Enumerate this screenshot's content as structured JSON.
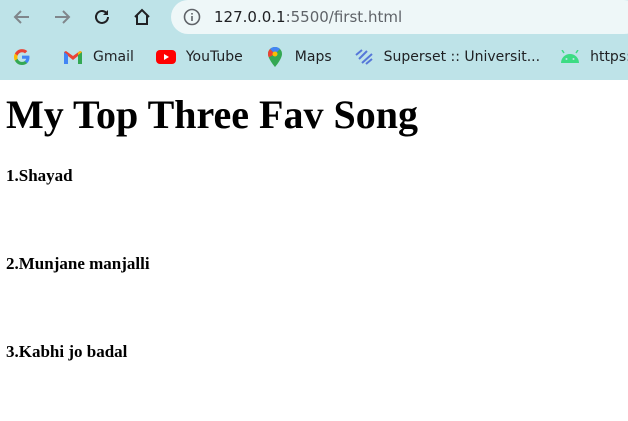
{
  "browser": {
    "url_host": "127.0.0.1",
    "url_rest": ":5500/first.html",
    "bookmarks": [
      {
        "label": "",
        "icon": "google-icon"
      },
      {
        "label": "Gmail",
        "icon": "gmail-icon"
      },
      {
        "label": "YouTube",
        "icon": "youtube-icon"
      },
      {
        "label": "Maps",
        "icon": "maps-icon"
      },
      {
        "label": "Superset :: Universit...",
        "icon": "superset-icon"
      },
      {
        "label": "https://dev",
        "icon": "android-icon"
      }
    ],
    "colors": {
      "chrome_bg": "#bee3e8",
      "omnibox_bg": "#eef7f8"
    }
  },
  "page": {
    "title": "My Top Three Fav Song",
    "songs": [
      "1.Shayad",
      "2.Munjane manjalli",
      "3.Kabhi jo badal"
    ]
  }
}
